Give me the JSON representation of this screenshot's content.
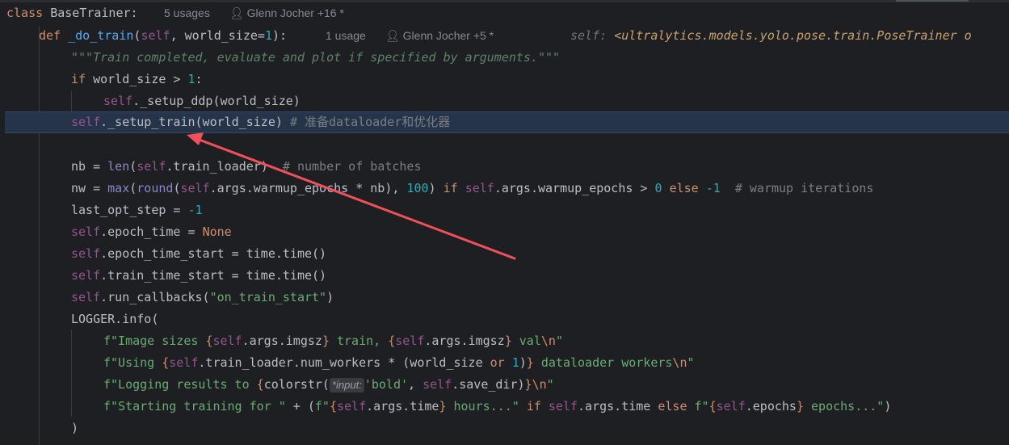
{
  "class_line": {
    "kw": "class ",
    "name": "BaseTrainer",
    "colon": ":",
    "usages": "5 usages",
    "author": "Glenn Jocher +16 *"
  },
  "def_line": {
    "kw": "def ",
    "name": "_do_train",
    "open": "(",
    "self": "self",
    "params": ", world_size=",
    "default": "1",
    "close": "):",
    "usages": "1 usage",
    "author": "Glenn Jocher +5 *",
    "type_hint_label": "self: ",
    "type_hint_value": "<ultralytics.models.yolo.pose.train.PoseTrainer o"
  },
  "inlay_hint": "*input:",
  "colors": {
    "background": "#1e1f22",
    "highlight": "#26344a",
    "arrow": "#f0505a",
    "keyword": "#cf8e6d",
    "function": "#56a8f5",
    "self": "#94558d",
    "number": "#2aacb8",
    "string": "#6aab73"
  },
  "code": {
    "docstring": "\"\"\"Train completed, evaluate and plot if specified by arguments.\"\"\"",
    "l3_kw": "if",
    "l3_rest": " world_size > ",
    "l3_num": "1",
    "l3_colon": ":",
    "l4_self": "self",
    "l4_rest": "._setup_ddp(world_size)",
    "l5_self": "self",
    "l5_rest": "._setup_train(world_size) ",
    "l5_comment": "# 准备dataloader和优化器",
    "l7_a": "nb = ",
    "l7_b": "len",
    "l7_c": "(",
    "l7_self": "self",
    "l7_d": ".train_loader)  ",
    "l7_comment": "# number of batches",
    "l8_a": "nw = ",
    "l8_max": "max",
    "l8_b": "(",
    "l8_round": "round",
    "l8_c": "(",
    "l8_self1": "self",
    "l8_d": ".args.warmup_epochs * nb), ",
    "l8_num100": "100",
    "l8_e": ") ",
    "l8_if": "if",
    "l8_f": " ",
    "l8_self2": "self",
    "l8_g": ".args.warmup_epochs > ",
    "l8_num0": "0",
    "l8_h": " ",
    "l8_else": "else",
    "l8_i": " ",
    "l8_neg1": "-1",
    "l8_j": "  ",
    "l8_comment": "# warmup iterations",
    "l9_a": "last_opt_step = ",
    "l9_num": "-1",
    "l10_self": "self",
    "l10_a": ".epoch_time = ",
    "l10_none": "None",
    "l11_self": "self",
    "l11_a": ".epoch_time_start = time.time()",
    "l12_self": "self",
    "l12_a": ".train_time_start = time.time()",
    "l13_self": "self",
    "l13_a": ".run_callbacks(",
    "l13_str": "\"on_train_start\"",
    "l13_b": ")",
    "l14": "LOGGER.info(",
    "l15_a": "f\"Image sizes ",
    "l15_b1": "{",
    "l15_self1": "self",
    "l15_c": ".args.imgsz",
    "l15_b2": "}",
    "l15_d": " train, ",
    "l15_b3": "{",
    "l15_self2": "self",
    "l15_e": ".args.imgsz",
    "l15_b4": "}",
    "l15_f": " val",
    "l15_esc": "\\n",
    "l15_g": "\"",
    "l16_a": "f\"Using ",
    "l16_b1": "{",
    "l16_self": "self",
    "l16_c": ".train_loader.num_workers * (world_size ",
    "l16_or": "or",
    "l16_d": " ",
    "l16_num": "1",
    "l16_e": ")",
    "l16_b2": "}",
    "l16_f": " dataloader workers",
    "l16_esc": "\\n",
    "l16_g": "\"",
    "l17_a": "f\"Logging results to ",
    "l17_b1": "{",
    "l17_c": "colorstr(",
    "l17_str": "'bold'",
    "l17_d": ", ",
    "l17_self": "self",
    "l17_e": ".save_dir)",
    "l17_b2": "}",
    "l17_esc": "\\n",
    "l17_f": "\"",
    "l18_a": "f\"Starting training for \"",
    "l18_b": " + (",
    "l18_c": "f\"",
    "l18_b1": "{",
    "l18_self1": "self",
    "l18_d": ".args.time",
    "l18_b2": "}",
    "l18_e": " hours...\"",
    "l18_f": " ",
    "l18_if": "if",
    "l18_g": " ",
    "l18_self2": "self",
    "l18_h": ".args.time ",
    "l18_else": "else",
    "l18_i": " ",
    "l18_j": "f\"",
    "l18_b3": "{",
    "l18_self3": "self",
    "l18_k": ".epochs",
    "l18_b4": "}",
    "l18_l": " epochs...\"",
    "l18_m": ")",
    "l19": ")"
  }
}
